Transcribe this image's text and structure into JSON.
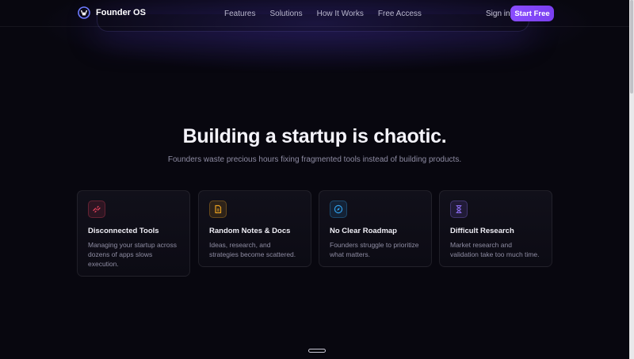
{
  "brand": {
    "name": "Founder OS"
  },
  "nav": {
    "links": [
      "Features",
      "Solutions",
      "How It Works",
      "Free Access"
    ],
    "signin": "Sign in",
    "cta": "Start Free"
  },
  "section": {
    "title": "Building a startup is chaotic.",
    "subtitle": "Founders waste precious hours fixing fragmented tools instead of building products.",
    "cards": [
      {
        "title": "Disconnected Tools",
        "desc": "Managing your startup across dozens of apps slows execution.",
        "icon": "broken-link-icon",
        "color": "#e0405a"
      },
      {
        "title": "Random Notes & Docs",
        "desc": "Ideas, research, and strategies become scattered.",
        "icon": "document-icon",
        "color": "#e8a020"
      },
      {
        "title": "No Clear Roadmap",
        "desc": "Founders struggle to prioritize what matters.",
        "icon": "compass-icon",
        "color": "#2f9ee8"
      },
      {
        "title": "Difficult Research",
        "desc": "Market research and validation take too much time.",
        "icon": "hourglass-icon",
        "color": "#8b6cf0"
      }
    ]
  }
}
